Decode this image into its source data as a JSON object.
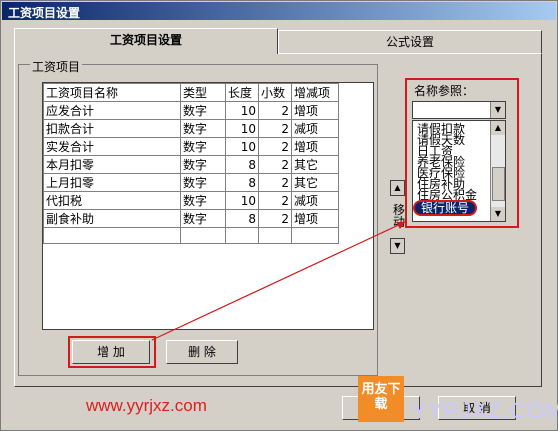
{
  "window": {
    "title": "工资项目设置"
  },
  "tabs": [
    {
      "label": "工资项目设置"
    },
    {
      "label": "公式设置"
    }
  ],
  "group": {
    "label": "工资项目"
  },
  "table": {
    "headers": [
      "工资项目名称",
      "类型",
      "长度",
      "小数",
      "增减项"
    ],
    "rows": [
      [
        "应发合计",
        "数字",
        "10",
        "2",
        "增项"
      ],
      [
        "扣款合计",
        "数字",
        "10",
        "2",
        "减项"
      ],
      [
        "实发合计",
        "数字",
        "10",
        "2",
        "增项"
      ],
      [
        "本月扣零",
        "数字",
        "8",
        "2",
        "其它"
      ],
      [
        "上月扣零",
        "数字",
        "8",
        "2",
        "其它"
      ],
      [
        "代扣税",
        "数字",
        "10",
        "2",
        "减项"
      ],
      [
        "副食补助",
        "数字",
        "8",
        "2",
        "增项"
      ]
    ]
  },
  "buttons": {
    "add": "增 加",
    "delete": "删 除",
    "cancel": "取 消"
  },
  "reference": {
    "label": "名称参照：",
    "combo_value": "",
    "items": [
      "请假扣款",
      "请假天数",
      "日工资",
      "养老保险",
      "医疗保险",
      "住房补助",
      "住房公积金",
      "银行账号"
    ],
    "selected": "银行账号"
  },
  "move": {
    "label": "移动"
  },
  "watermark": {
    "site": "www.yyrjxz.com",
    "logo": "用友下载",
    "brand": "YYRJXZ.COM"
  },
  "colors": {
    "annotation_red": "#d11b1b",
    "selection": "#0a246a",
    "titlebar": "#0a246a"
  }
}
